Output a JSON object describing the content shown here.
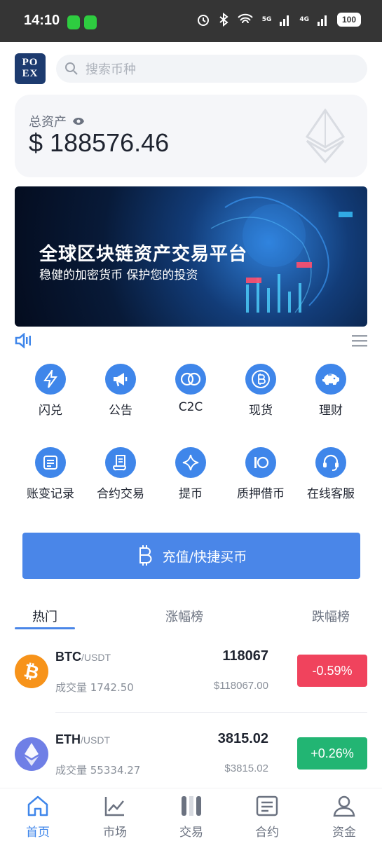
{
  "status_bar": {
    "time": "14:10",
    "battery": "100",
    "net1": "5G",
    "net2": "4G"
  },
  "header": {
    "logo_line1": "PO",
    "logo_line2": "EX",
    "search_placeholder": "搜索币种"
  },
  "asset": {
    "label": "总资产",
    "value": "$ 188576.46"
  },
  "banner": {
    "title": "全球区块链资产交易平台",
    "subtitle": "稳健的加密货币 保护您的投资"
  },
  "features": [
    {
      "label": "闪兑",
      "icon": "lightning-icon"
    },
    {
      "label": "公告",
      "icon": "megaphone-icon"
    },
    {
      "label": "C2C",
      "icon": "c2c-icon"
    },
    {
      "label": "现货",
      "icon": "bitcoin-icon"
    },
    {
      "label": "理财",
      "icon": "piggy-bank-icon"
    },
    {
      "label": "账变记录",
      "icon": "document-icon"
    },
    {
      "label": "合约交易",
      "icon": "contract-icon"
    },
    {
      "label": "提币",
      "icon": "sparkle-icon"
    },
    {
      "label": "质押借币",
      "icon": "pledge-icon"
    },
    {
      "label": "在线客服",
      "icon": "headset-icon"
    }
  ],
  "deposit_button": {
    "label": "充值/快捷买币"
  },
  "tabs": [
    {
      "label": "热门"
    },
    {
      "label": "涨幅榜"
    },
    {
      "label": "跌幅榜"
    }
  ],
  "market": [
    {
      "symbol": "BTC",
      "quote": "/USDT",
      "volume": "成交量 1742.50",
      "price": "118067",
      "usd": "$118067.00",
      "change": "-0.59%",
      "color": "#f0435d"
    },
    {
      "symbol": "ETH",
      "quote": "/USDT",
      "volume": "成交量 55334.27",
      "price": "3815.02",
      "usd": "$3815.02",
      "change": "+0.26%",
      "color": "#22b573"
    }
  ],
  "bottom_nav": [
    {
      "label": "首页",
      "icon": "home-icon"
    },
    {
      "label": "市场",
      "icon": "chart-icon"
    },
    {
      "label": "交易",
      "icon": "trade-icon"
    },
    {
      "label": "合约",
      "icon": "contract-icon"
    },
    {
      "label": "资金",
      "icon": "user-icon"
    }
  ],
  "colors": {
    "accent": "#4a86e8",
    "down": "#f0435d",
    "up": "#22b573"
  }
}
